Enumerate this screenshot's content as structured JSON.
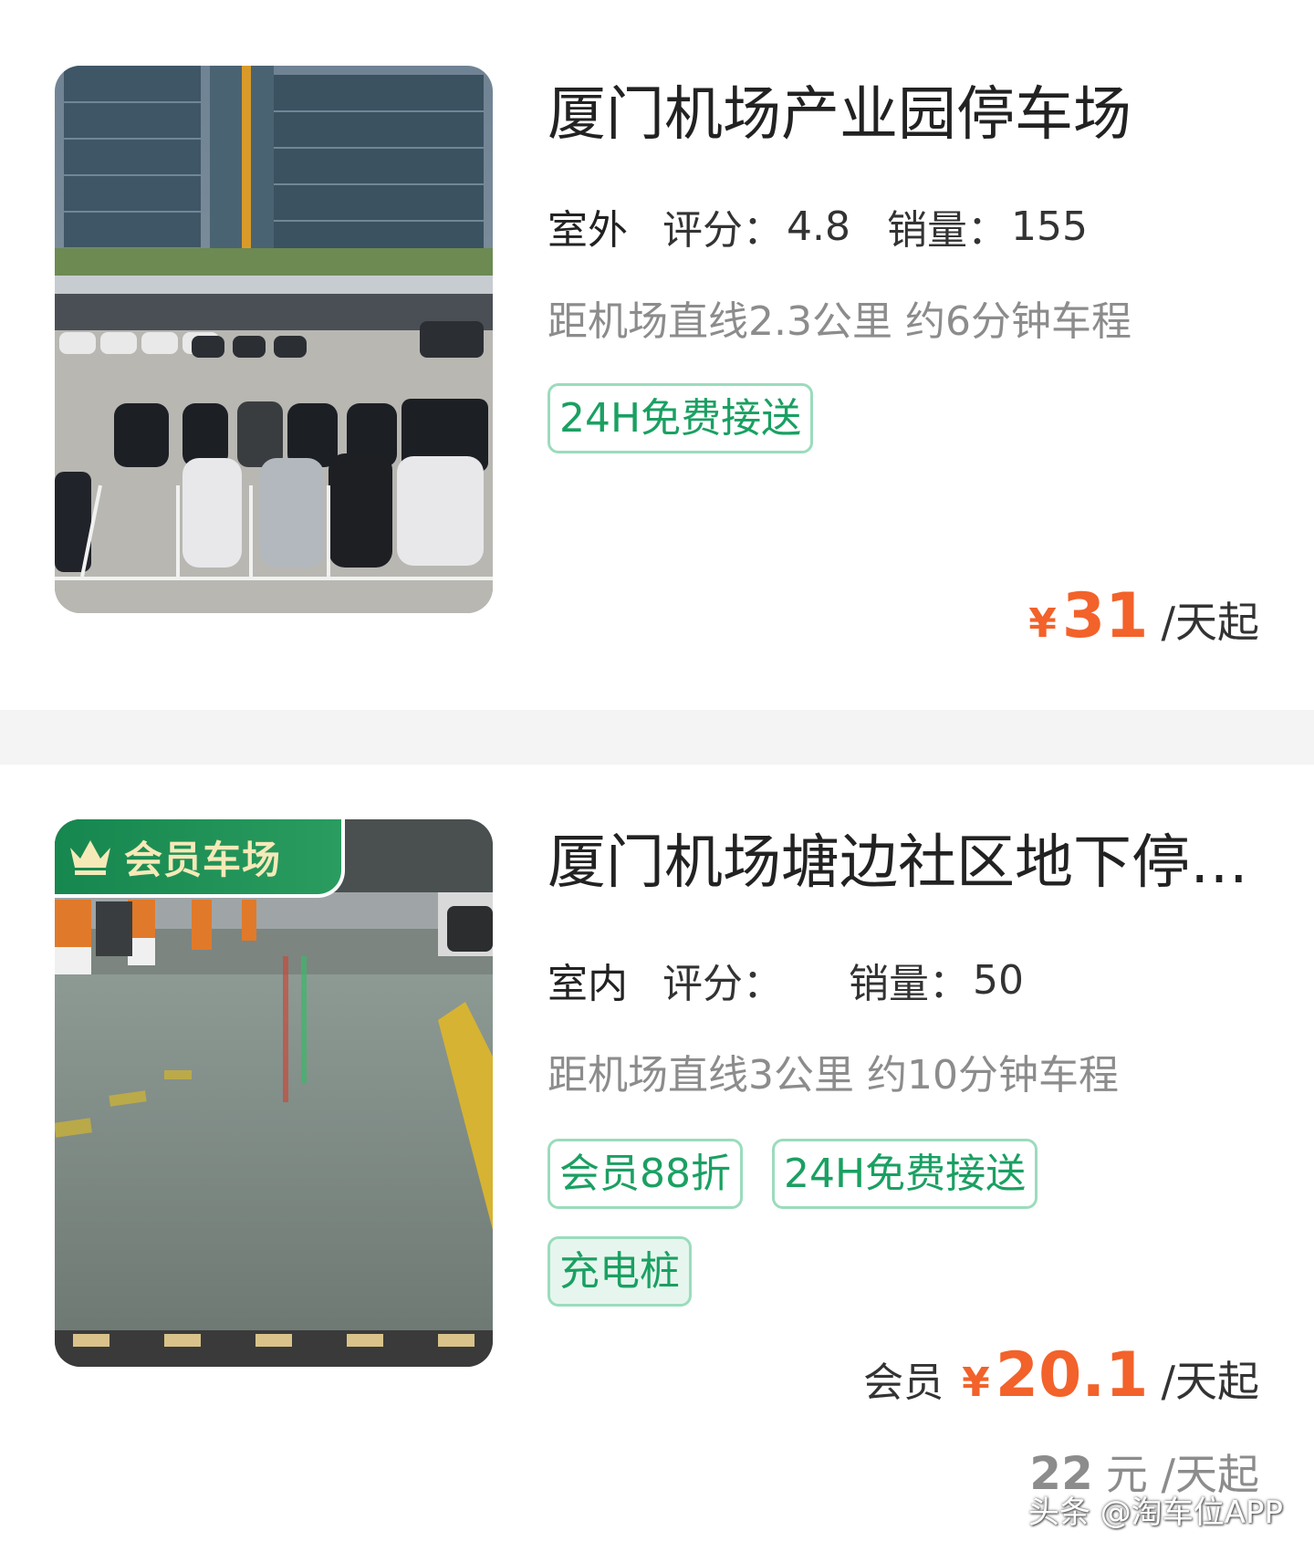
{
  "colors": {
    "accent_green": "#1aa062",
    "price_orange": "#f2622a",
    "member_gold": "#f6e9b8"
  },
  "lots": [
    {
      "name": "厦门机场产业园停车场",
      "type": "室外",
      "rating_label": "评分：",
      "rating": "4.8",
      "sales_label": "销量：",
      "sales": "155",
      "distance": "距机场直线2.3公里 约6分钟车程",
      "tags": [
        "24H免费接送"
      ],
      "price_currency": "¥",
      "price": "31",
      "price_unit": "/天起",
      "image_icon": "parking-lot-photo"
    },
    {
      "badge": "会员车场",
      "badge_icon": "crown-icon",
      "name": "厦门机场塘边社区地下停…",
      "type": "室内",
      "rating_label": "评分：",
      "rating": "",
      "sales_label": "销量：",
      "sales": "50",
      "distance": "距机场直线3公里 约10分钟车程",
      "tags": [
        "会员88折",
        "24H免费接送",
        "充电桩"
      ],
      "member_label": "会员",
      "price_currency": "¥",
      "price": "20.1",
      "price_unit": "/天起",
      "original_price": "22",
      "original_unit": "元 /天起",
      "image_icon": "underground-garage-photo"
    }
  ],
  "watermark": "头条 @淘车位APP"
}
